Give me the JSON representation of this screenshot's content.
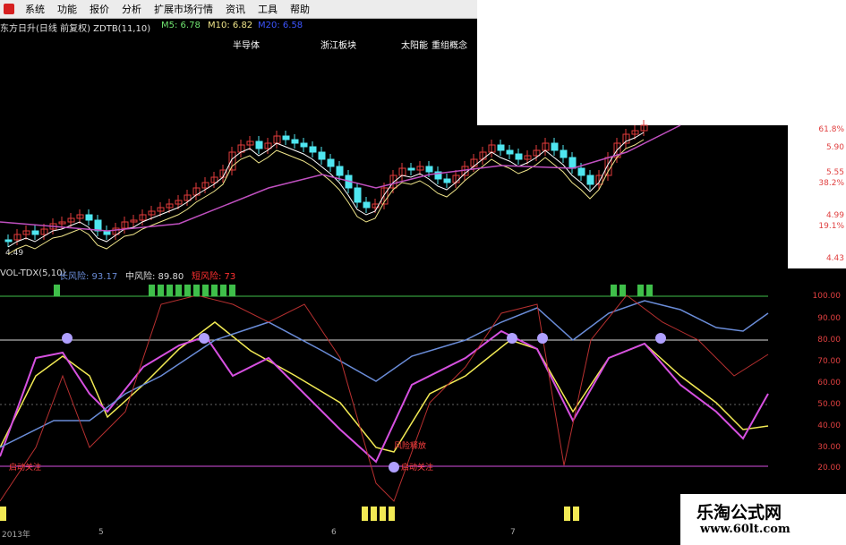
{
  "menu": [
    "系统",
    "功能",
    "报价",
    "分析",
    "扩展市场行情",
    "资讯",
    "工具",
    "帮助"
  ],
  "header": {
    "stock": "东方日升(日线 前复权) ZDTB(11,10)",
    "m5": "M5: 6.78",
    "m10": "M10: 6.82",
    "m20": "M20: 6.58"
  },
  "concepts": [
    "半导体",
    "浙江板块",
    "太阳能",
    "重组概念"
  ],
  "price_axis": [
    "61.8%",
    "5.90",
    "5.55",
    "38.2%",
    "4.99",
    "19.1%",
    "4.43"
  ],
  "price_low_label": "4.49",
  "indicator": {
    "name": "VOL-TDX(5,10)",
    "long": "长风险: 93.17",
    "mid": "中风险: 89.80",
    "short": "短风险: 73"
  },
  "ind_axis": [
    "100.00",
    "90.00",
    "80.00",
    "70.00",
    "60.00",
    "50.00",
    "40.00",
    "30.00",
    "20.00"
  ],
  "signals": [
    "启动关注",
    "启动关注",
    "风险释放"
  ],
  "dates": [
    "2013年",
    "5",
    "6",
    "7"
  ],
  "watermark": {
    "title": "乐淘公式网",
    "url": "www.60lt.com"
  },
  "colors": {
    "up": "#e23b3b",
    "down": "#4fe6f0",
    "ma5": "#ffffff",
    "ma10": "#f0e58a",
    "ma20": "#c050c0",
    "yellow": "#f2ea54",
    "magenta": "#d650e0",
    "blue": "#6a8cd8",
    "green": "#3fbf4a"
  }
}
